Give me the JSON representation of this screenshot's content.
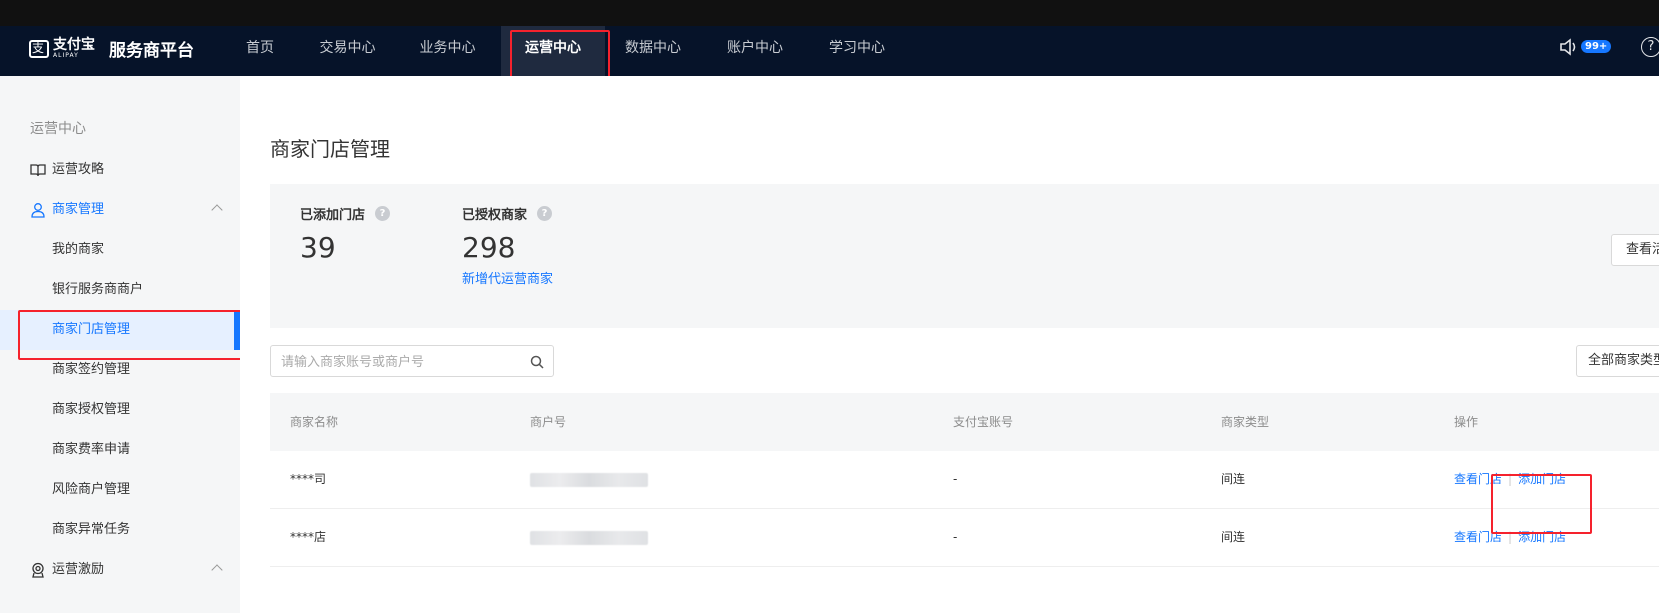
{
  "brand": {
    "logo_cn": "支付宝",
    "logo_en": "ALIPAY",
    "platform": "服务商平台",
    "accent_color": "#1677ff"
  },
  "topnav": {
    "items": [
      {
        "label": "首页"
      },
      {
        "label": "交易中心"
      },
      {
        "label": "业务中心"
      },
      {
        "label": "运营中心",
        "active": true
      },
      {
        "label": "数据中心"
      },
      {
        "label": "账户中心"
      },
      {
        "label": "学习中心"
      }
    ],
    "notification_count": "99+",
    "notification_icon": "speaker-icon",
    "help_icon": "help-icon",
    "help_label": "?"
  },
  "sidebar": {
    "section_title": "运营中心",
    "items": [
      {
        "label": "运营攻略",
        "icon": "book-icon"
      },
      {
        "label": "商家管理",
        "icon": "user-icon",
        "expanded": true
      },
      {
        "label": "我的商家"
      },
      {
        "label": "银行服务商商户"
      },
      {
        "label": "商家门店管理",
        "selected": true
      },
      {
        "label": "商家签约管理"
      },
      {
        "label": "商家授权管理"
      },
      {
        "label": "商家费率申请"
      },
      {
        "label": "风险商户管理"
      },
      {
        "label": "商家异常任务"
      },
      {
        "label": "运营激励",
        "icon": "badge-icon",
        "expanded": true
      }
    ]
  },
  "main": {
    "title": "商家门店管理",
    "stats": {
      "added_stores_label": "已添加门店",
      "added_stores_value": "39",
      "authorized_merchants_label": "已授权商家",
      "authorized_merchants_value": "298",
      "add_merchant_link": "新增代运营商家",
      "view_button": "查看活动"
    },
    "search": {
      "placeholder": "请输入商家账号或商户号"
    },
    "filter": {
      "selected": "全部商家类型"
    },
    "table": {
      "columns": [
        "商家名称",
        "商户号",
        "支付宝账号",
        "商家类型",
        "操作"
      ],
      "rows": [
        {
          "name": "****司",
          "merchant_id": "",
          "alipay_account": "-",
          "type": "间连",
          "action_view": "查看门店",
          "action_add": "添加门店"
        },
        {
          "name": "****店",
          "merchant_id": "",
          "alipay_account": "-",
          "type": "间连",
          "action_view": "查看门店",
          "action_add": "添加门店"
        }
      ]
    }
  }
}
